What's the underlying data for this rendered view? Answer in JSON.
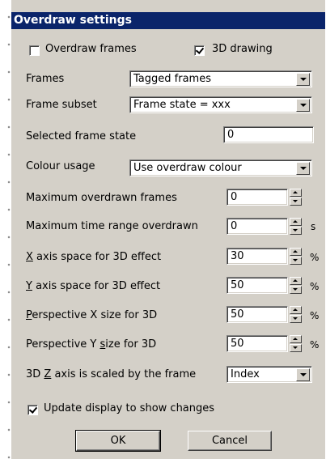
{
  "dialog": {
    "title": "Overdraw settings",
    "overdraw_frames": {
      "label": "Overdraw frames",
      "checked": false
    },
    "drawing_3d": {
      "label": "3D drawing",
      "checked": true
    },
    "frames": {
      "label": "Frames",
      "value": "Tagged frames"
    },
    "frame_subset": {
      "label": "Frame subset",
      "value": "Frame state = xxx"
    },
    "selected_frame_state": {
      "label": "Selected frame state",
      "value": "0"
    },
    "colour_usage": {
      "label": "Colour usage",
      "value": "Use overdraw colour"
    },
    "max_overdrawn_frames": {
      "label": "Maximum overdrawn frames",
      "value": "0"
    },
    "max_time_range": {
      "label": "Maximum time range overdrawn",
      "value": "0",
      "unit": "s"
    },
    "x_axis_space": {
      "mnemonic": "X",
      "rest": " axis space for 3D effect",
      "value": "30",
      "unit": "%"
    },
    "y_axis_space": {
      "mnemonic": "Y",
      "rest": " axis space for 3D effect",
      "value": "50",
      "unit": "%"
    },
    "perspective_x": {
      "mnemonic": "P",
      "rest": "erspective X size for 3D",
      "value": "50",
      "unit": "%"
    },
    "perspective_y": {
      "pre": "Perspective Y ",
      "mnemonic": "s",
      "rest": "ize for 3D",
      "value": "50",
      "unit": "%"
    },
    "z_axis": {
      "pre": "3D ",
      "mnemonic": "Z",
      "rest": " axis is scaled by the frame",
      "value": "Index"
    },
    "update_display": {
      "label": "Update display to show changes",
      "checked": true
    },
    "ok_label": "OK",
    "cancel_label": "Cancel"
  }
}
